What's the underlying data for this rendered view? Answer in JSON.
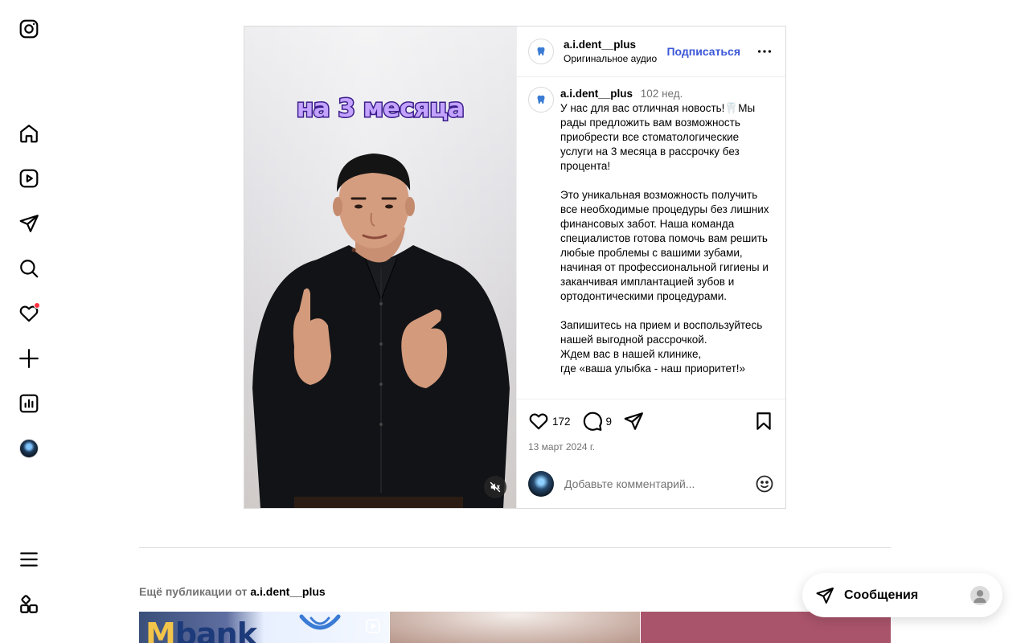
{
  "nav": {
    "items": [
      {
        "name": "instagram-logo-icon"
      },
      {
        "name": "home-icon"
      },
      {
        "name": "reels-icon"
      },
      {
        "name": "direct-icon"
      },
      {
        "name": "search-icon"
      },
      {
        "name": "notifications-heart-icon"
      },
      {
        "name": "create-plus-icon"
      },
      {
        "name": "dashboard-icon"
      },
      {
        "name": "profile-avatar"
      },
      {
        "name": "menu-icon"
      },
      {
        "name": "threads-apps-icon"
      }
    ]
  },
  "post": {
    "media": {
      "overlay_text": "на 3 месяца"
    },
    "header": {
      "username": "a.i.dent__plus",
      "audio": "Оригинальное аудио",
      "follow_label": "Подписаться"
    },
    "caption": {
      "username": "a.i.dent__plus",
      "time": "102 нед.",
      "text": "У нас для вас отличная новость!🦷Мы рады предложить вам возможность приобрести все стоматологические услуги на 3 месяца в рассрочку без процента!\n\nЭто уникальная возможность получить все необходимые процедуры без лишних финансовых забот. Наша команда специалистов готова помочь вам решить любые проблемы с вашими зубами, начиная от профессиональной гигиены и заканчивая имплантацией зубов и ортодонтическими процедурами.\n\nЗапишитесь на прием и воспользуйтесь нашей выгодной рассрочкой.\nЖдем вас в нашей клинике,\nгде «ваша улыбка - наш приоритет!»"
    },
    "likes": "172",
    "comments": "9",
    "date": "13 март 2024 г.",
    "comment_placeholder": "Добавьте комментарий..."
  },
  "more_posts": {
    "prefix": "Ещё публикации от",
    "username": "a.i.dent__plus",
    "thumb1_text": "bank",
    "thumb1_mark": "M"
  },
  "messages": {
    "label": "Сообщения"
  },
  "colors": {
    "follow": "#3b57d8",
    "notification_dot": "#ff3040",
    "overlay_text": "#c3a3ff"
  }
}
